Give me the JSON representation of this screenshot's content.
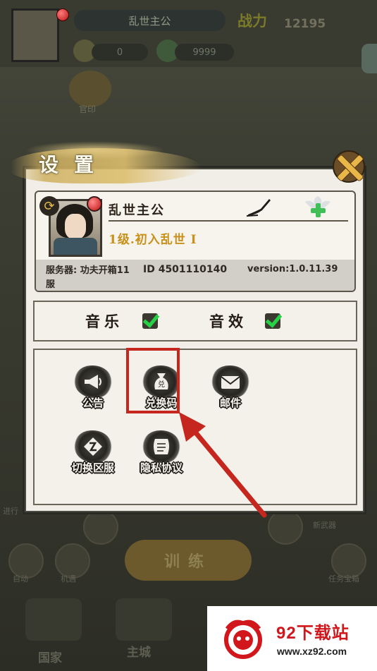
{
  "background": {
    "player_name": "乱世主公",
    "power_label": "战力",
    "power_value": "12195",
    "resource_1": "0",
    "resource_2": "9999",
    "round_icon_label": "官印",
    "train_label": "训练",
    "nav_country": "国家",
    "nav_city": "主城",
    "side_label_left": "进行",
    "side_label_right": "新武器",
    "bottom_icon_1": "自动",
    "bottom_icon_2": "机遇",
    "bottom_icon_3": "任务宝箱"
  },
  "dialog": {
    "title": "设置",
    "profile": {
      "name": "乱世主公",
      "level": "1级.初入乱世 I",
      "server": "服务器: 功夫开箱11服",
      "id": "ID  4501110140",
      "version": "version:1.0.11.39"
    },
    "sound": {
      "music_label": "音乐",
      "music_on": true,
      "sfx_label": "音效",
      "sfx_on": true
    },
    "functions": [
      {
        "label": "公告",
        "icon": "megaphone-icon"
      },
      {
        "label": "兑换码",
        "icon": "gift-bag-icon"
      },
      {
        "label": "邮件",
        "icon": "envelope-icon"
      },
      {
        "label": "切换区服",
        "icon": "switch-server-icon"
      },
      {
        "label": "隐私协议",
        "icon": "scroll-icon"
      }
    ]
  },
  "watermark": {
    "title": "92下载站",
    "url": "www.xz92.com",
    "brand_color": "#d1171b"
  },
  "highlight_color": "#c5271f"
}
